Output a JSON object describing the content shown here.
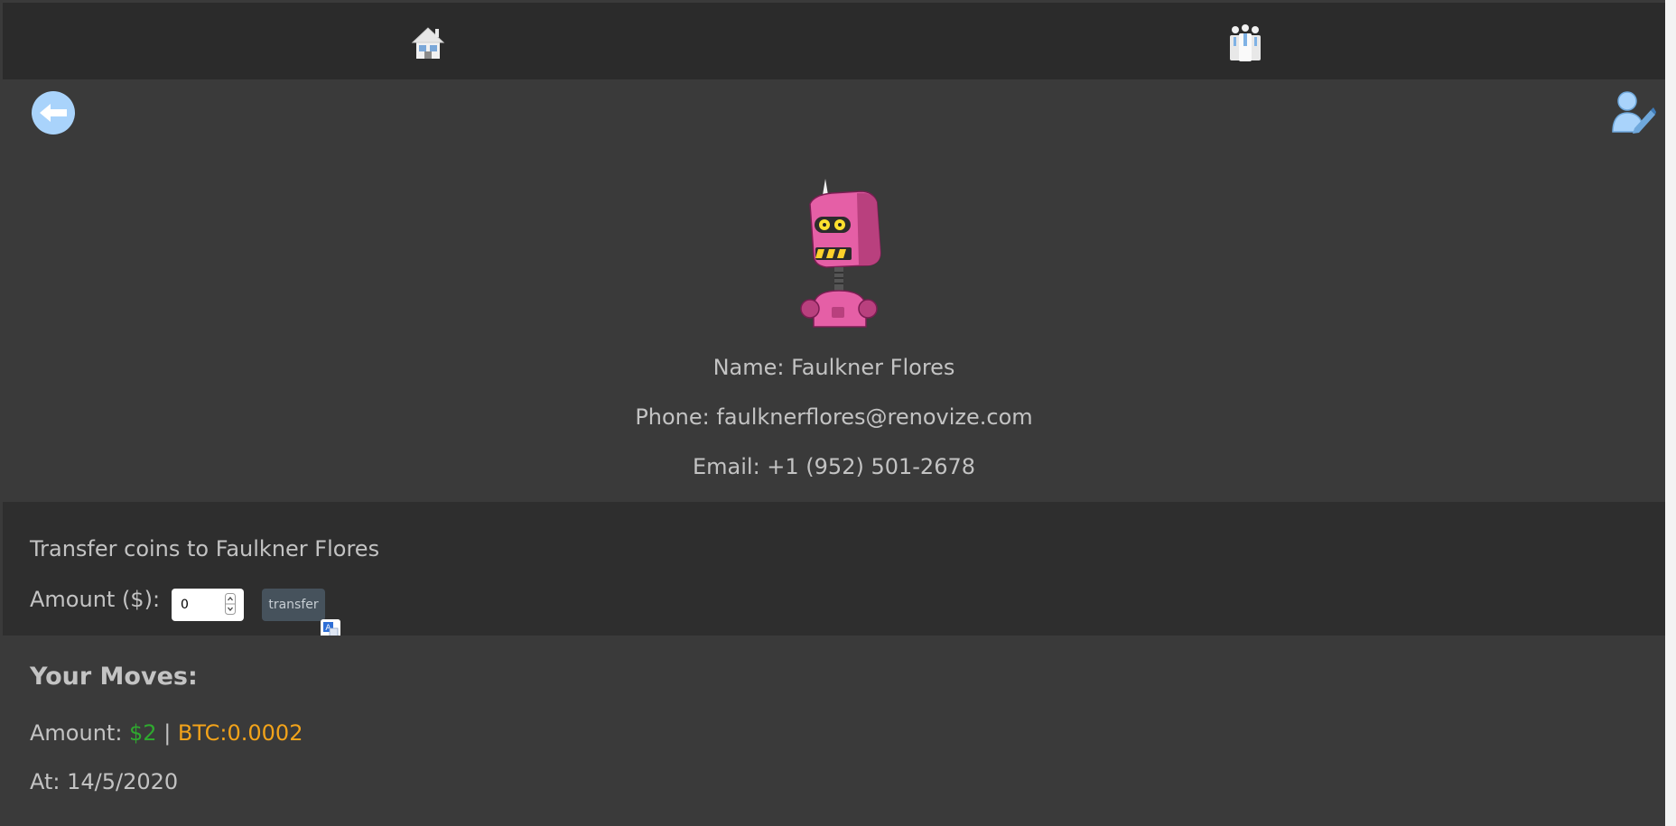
{
  "icons": {
    "home": "home-icon",
    "contacts": "contacts-icon",
    "back": "arrow-left-icon",
    "edit": "edit-user-icon",
    "translate": "translate-icon"
  },
  "colors": {
    "usd": "#2fa82f",
    "btc": "#f2a31a"
  },
  "contact": {
    "name_line": "Name: Faulkner Flores",
    "phone_line": "Phone: faulknerflores@renovize.com",
    "email_line": "Email: +1 (952) 501-2678"
  },
  "transfer": {
    "title": "Transfer coins to Faulkner Flores",
    "amount_label": "Amount ($):",
    "amount_value": "0",
    "button_label": "transfer"
  },
  "moves": {
    "title": "Your Moves:",
    "amount_prefix": "Amount: ",
    "usd": "$2",
    "separator": " | ",
    "btc": "BTC:0.0002",
    "at": "At: 14/5/2020"
  }
}
